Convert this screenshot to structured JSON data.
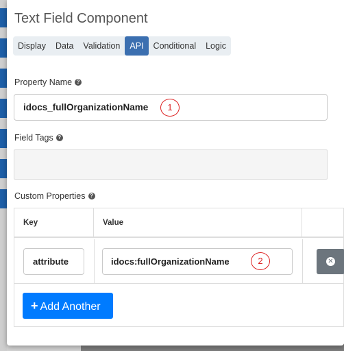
{
  "modal": {
    "title": "Text Field Component"
  },
  "tabs": [
    {
      "label": "Display",
      "active": false
    },
    {
      "label": "Data",
      "active": false
    },
    {
      "label": "Validation",
      "active": false
    },
    {
      "label": "API",
      "active": true
    },
    {
      "label": "Conditional",
      "active": false
    },
    {
      "label": "Logic",
      "active": false
    }
  ],
  "property_name": {
    "label": "Property Name",
    "value": "idocs_fullOrganizationName",
    "annotation": "1"
  },
  "field_tags": {
    "label": "Field Tags",
    "value": ""
  },
  "custom_properties": {
    "label": "Custom Properties",
    "columns": {
      "key": "Key",
      "value": "Value"
    },
    "rows": [
      {
        "key": "attribute",
        "value": "idocs:fullOrganizationName",
        "annotation": "2"
      }
    ],
    "add_label": "Add Another"
  },
  "icons": {
    "help": "question-circle-icon",
    "remove": "times-circle-icon",
    "add": "plus-icon"
  },
  "colors": {
    "active_tab": "#3b6fb0",
    "primary_button": "#007bff",
    "remove_button": "#6c757d",
    "annotation": "#dd2222"
  }
}
